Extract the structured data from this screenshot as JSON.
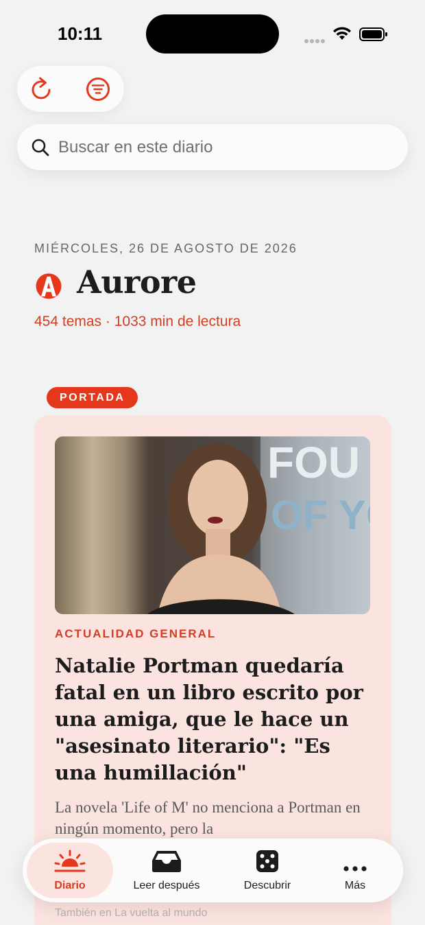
{
  "status_bar": {
    "time": "10:11"
  },
  "toolbar": {
    "reload_icon": "reload-icon",
    "filter_icon": "filter-icon"
  },
  "search": {
    "placeholder": "Buscar en este diario",
    "value": ""
  },
  "header": {
    "date": "MIÉRCOLES, 26 DE AGOSTO DE 2026",
    "paper_name": "Aurore",
    "meta": "454 temas · 1033 min de lectura"
  },
  "section": {
    "badge": "PORTADA"
  },
  "article": {
    "category": "ACTUALIDAD GENERAL",
    "headline": "Natalie Portman quedaría fatal en un libro escrito por una amiga, que le hace un \"asesinato literario\": \"Es una humillación\"",
    "summary": "La novela 'Life of M' no menciona a Portman en ningún momento, pero la",
    "related": "También en La vuelta al mundo"
  },
  "tabs": [
    {
      "label": "Diario",
      "icon": "sunrise-icon",
      "active": true
    },
    {
      "label": "Leer después",
      "icon": "inbox-tray-icon",
      "active": false
    },
    {
      "label": "Descubrir",
      "icon": "dice-icon",
      "active": false
    },
    {
      "label": "Más",
      "icon": "more-dots-icon",
      "active": false
    }
  ],
  "colors": {
    "accent": "#e5371c",
    "accent_text": "#d13e24",
    "card_bg": "#fbe3df",
    "page_bg": "#f2f2f2"
  }
}
